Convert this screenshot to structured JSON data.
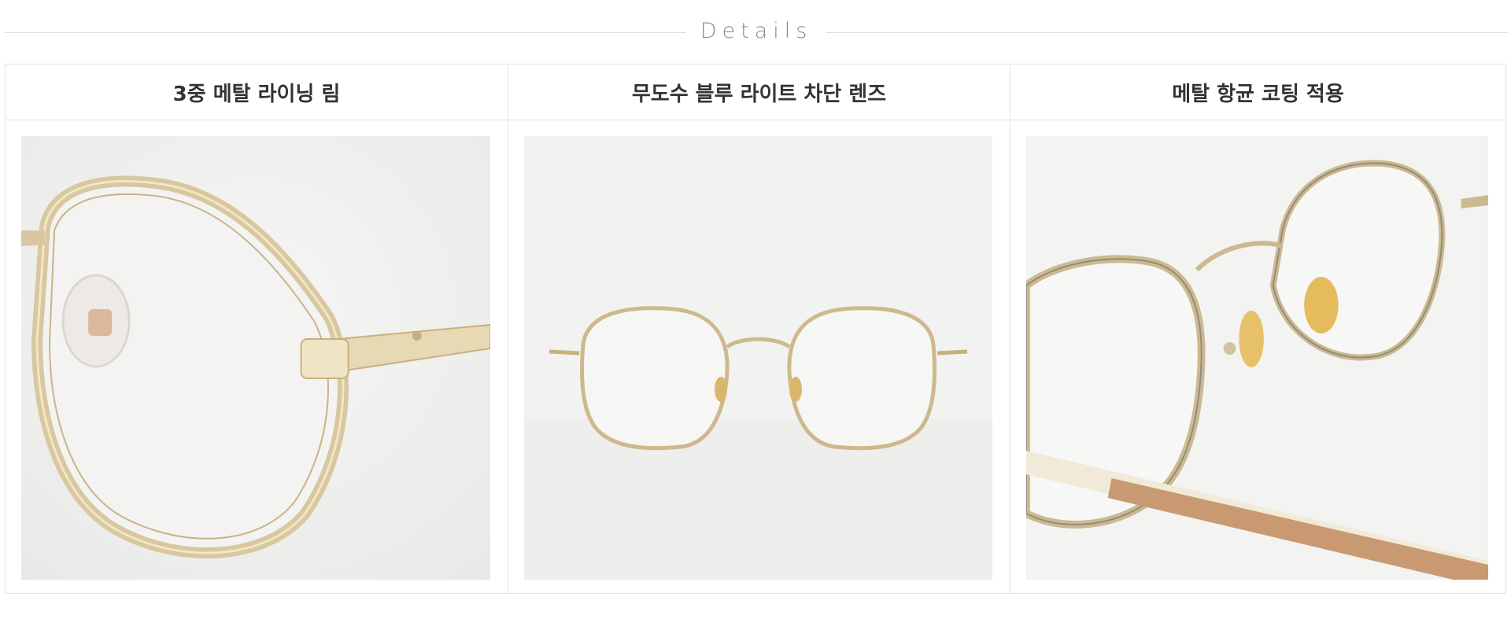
{
  "section": {
    "title": "Details"
  },
  "features": [
    {
      "title": "3중 메탈 라이닝 림",
      "image": "closeup-triple-metal-lining-rim"
    },
    {
      "title": "무도수 블루 라이트 차단 렌즈",
      "image": "front-view-glasses"
    },
    {
      "title": "메탈 항균 코팅 적용",
      "image": "angled-view-nose-pads"
    }
  ],
  "colors": {
    "frame_gold": "#d8c79f",
    "background": "#f1f1f0",
    "temple_tip": "#c99a72"
  }
}
